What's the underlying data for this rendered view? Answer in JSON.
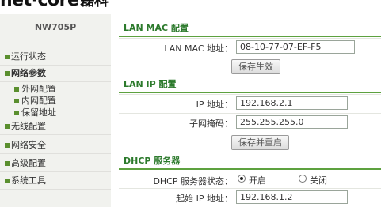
{
  "brand": {
    "name": "net·core",
    "cn": "磊科"
  },
  "sidebar": {
    "model": "NW705P",
    "items": [
      {
        "label": "运行状态"
      },
      {
        "label": "网络参数"
      },
      {
        "label": "无线配置"
      },
      {
        "label": "网络安全"
      },
      {
        "label": "高级配置"
      },
      {
        "label": "系统工具"
      }
    ],
    "subitems": [
      {
        "label": "外网配置"
      },
      {
        "label": "内网配置"
      },
      {
        "label": "保留地址"
      }
    ]
  },
  "lan_mac": {
    "title": "LAN MAC 配置",
    "mac_label": "LAN MAC 地址：",
    "mac_value": "08-10-77-07-EF-F5",
    "save_button": "保存生效"
  },
  "lan_ip": {
    "title": "LAN IP 配置",
    "ip_label": "IP 地址：",
    "ip_value": "192.168.2.1",
    "mask_label": "子网掩码：",
    "mask_value": "255.255.255.0",
    "save_restart_button": "保存并重启"
  },
  "dhcp": {
    "title": "DHCP 服务器",
    "status_label": "DHCP 服务器状态：",
    "on_label": "开启",
    "off_label": "关闭",
    "selected": "开启",
    "start_ip_label": "起始 IP 地址：",
    "start_ip_value": "192.168.1.2"
  }
}
